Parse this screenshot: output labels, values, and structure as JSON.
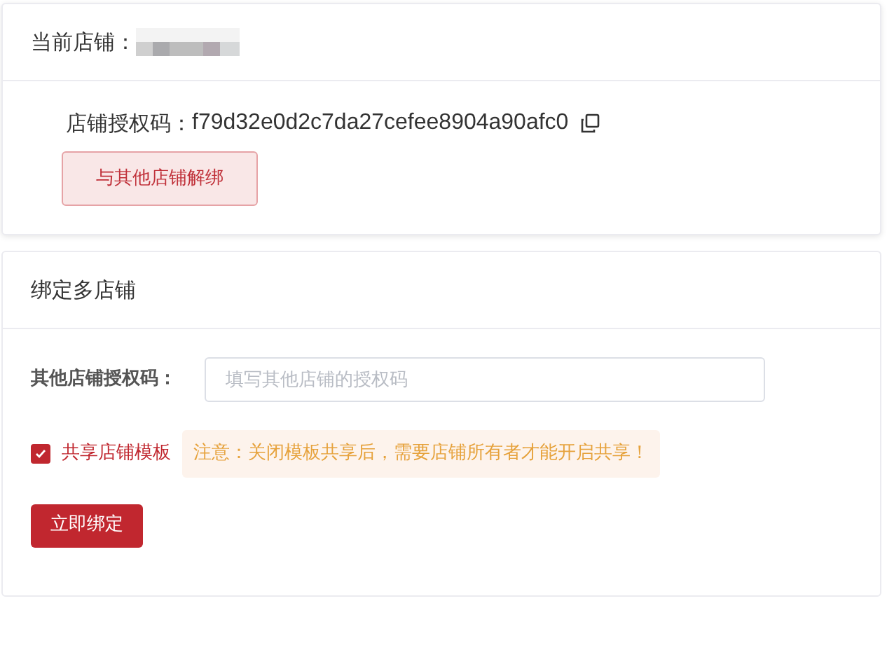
{
  "current_store": {
    "label": "当前店铺："
  },
  "auth": {
    "label": "店铺授权码：",
    "code": "f79d32e0d2c7da27cefee8904a90afc0",
    "unbind_button": "与其他店铺解绑"
  },
  "bind": {
    "title": "绑定多店铺",
    "field_label": "其他店铺授权码：",
    "placeholder": "填写其他店铺的授权码",
    "share": {
      "label": "共享店铺模板",
      "checked": true
    },
    "notice": "注意：关闭模板共享后，需要店铺所有者才能开启共享！",
    "submit_button": "立即绑定"
  }
}
